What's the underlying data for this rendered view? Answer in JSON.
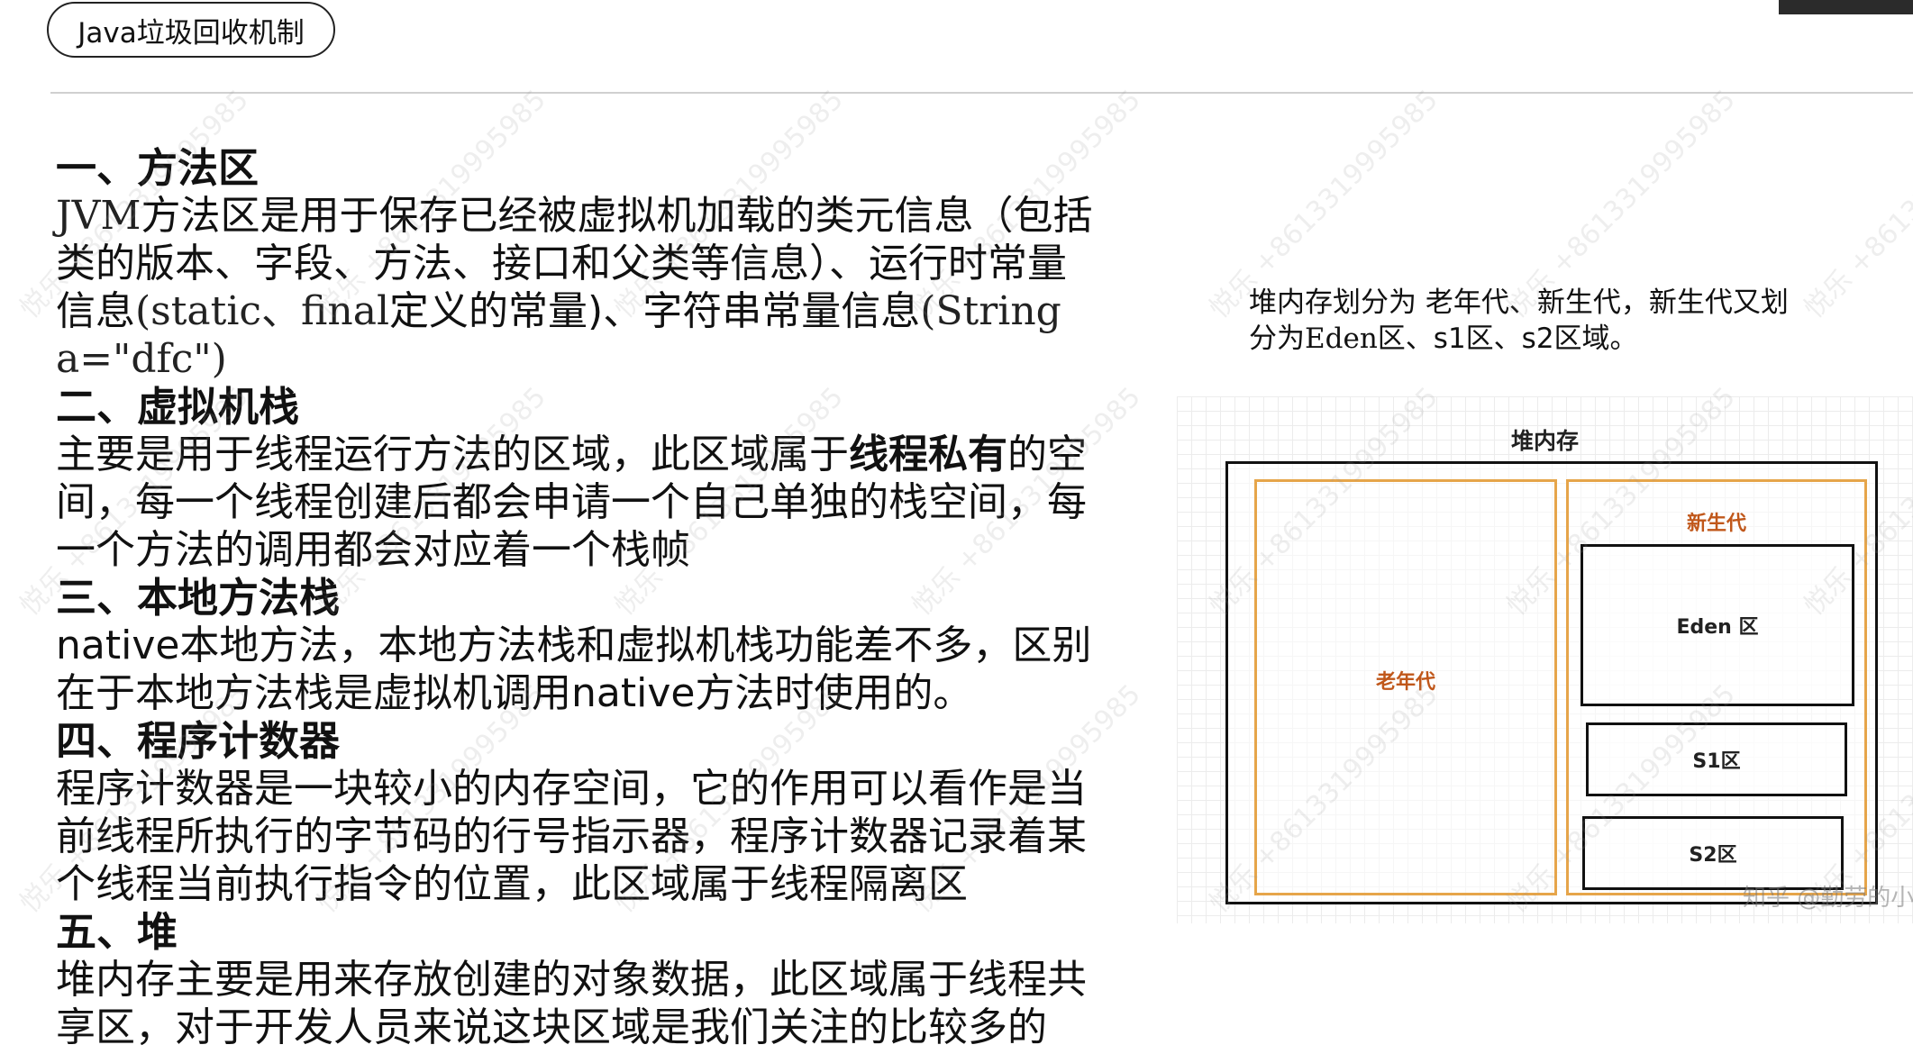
{
  "header": {
    "title": "Java垃圾回收机制"
  },
  "sections": [
    {
      "heading": "一、方法区",
      "body_serif_1": "JVM",
      "body_1": "方法区是用于保存已经被虚拟机加载的类元信息（包括类的版本、字段、方法、接口和父类等信息）、运行时常量信息",
      "body_serif_2": "(static、final",
      "body_2": "定义的常量)、字符串常量信息",
      "body_serif_3": "(String a=\"dfc\")"
    },
    {
      "heading": "二、虚拟机栈",
      "body_pre": "主要是用于线程运行方法的区域，此区域属于",
      "body_bold": "线程私有",
      "body_post": "的空间，每一个线程创建后都会申请一个自己单独的栈空间，每一个方法的调用都会对应着一个栈帧"
    },
    {
      "heading": "三、本地方法栈",
      "body": "native本地方法，本地方法栈和虚拟机栈功能差不多，区别在于本地方法栈是虚拟机调用native方法时使用的。"
    },
    {
      "heading": "四、程序计数器",
      "body": "程序计数器是一块较小的内存空间，它的作用可以看作是当前线程所执行的字节码的行号指示器，程序计数器记录着某个线程当前执行指令的位置，此区域属于线程隔离区"
    },
    {
      "heading": "五、堆",
      "body": "堆内存主要是用来存放创建的对象数据，此区域属于线程共享区，对于开发人员来说这块区域是我们关注的比较多的"
    }
  ],
  "caption": {
    "line1": "堆内存划分为 老年代、新生代，新生代又划",
    "line2_pre": "分为",
    "line2_serif": "Eden",
    "line2_post": "区、s1区、s2区域。"
  },
  "diagram": {
    "heap_label": "堆内存",
    "old_label": "老年代",
    "young_label": "新生代",
    "eden_label": "Eden 区",
    "s1_label": "S1区",
    "s2_label": "S2区",
    "accent_color": "#e6a54a",
    "label_color": "#c0571a"
  },
  "watermark": {
    "text": "悦乐 +8613319995985",
    "source": "知乎 @勤劳的小"
  }
}
